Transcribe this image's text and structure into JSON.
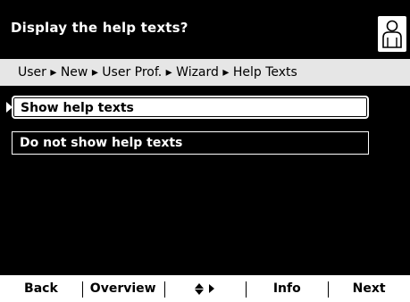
{
  "header": {
    "title": "Display the help texts?",
    "user_icon": "user-profile-icon"
  },
  "breadcrumb": {
    "text": "User ▸ New ▸ User Prof. ▸ Wizard ▸ Help Texts"
  },
  "options": [
    {
      "label": "Show help texts",
      "selected": true
    },
    {
      "label": "Do not show help texts",
      "selected": false
    }
  ],
  "softkeys": {
    "back": "Back",
    "overview": "Overview",
    "navigate_icon": "up-down-right-arrows-icon",
    "info": "Info",
    "next": "Next"
  },
  "colors": {
    "background": "#000000",
    "foreground": "#ffffff",
    "breadcrumb_bg": "#e6e6e6",
    "softkey_bg": "#ffffff"
  }
}
